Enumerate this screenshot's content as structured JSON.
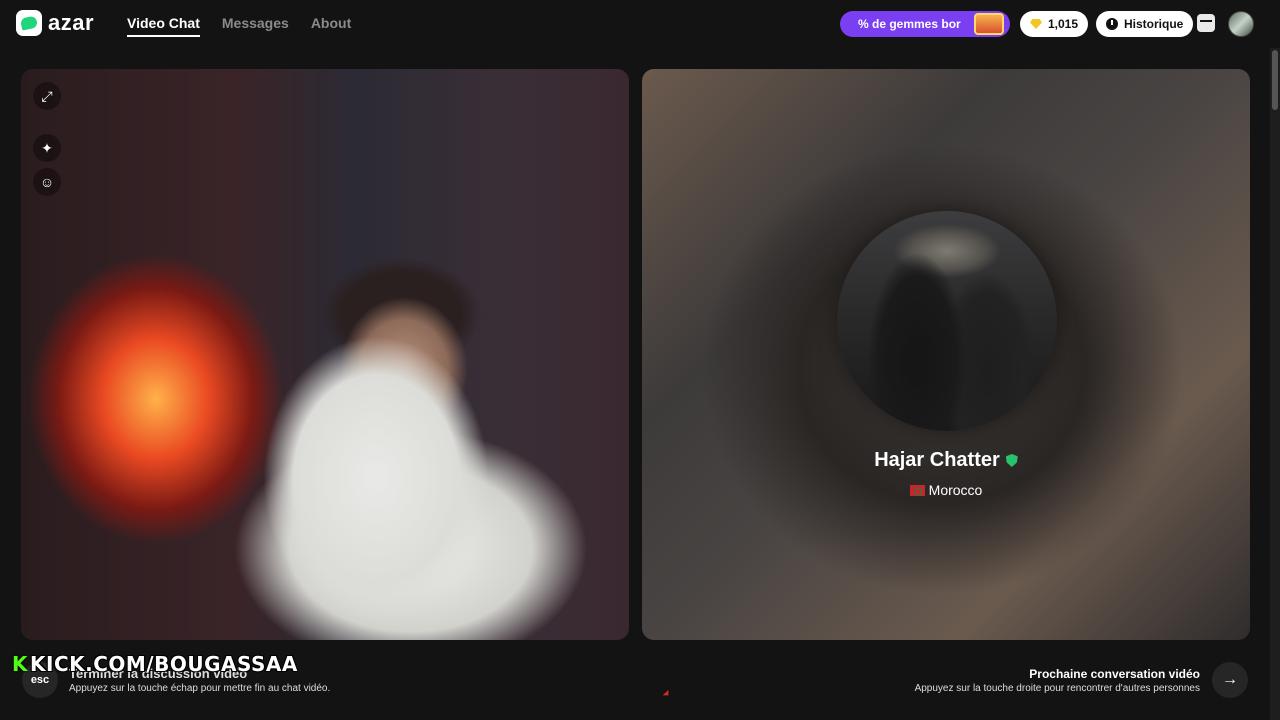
{
  "header": {
    "logo_text": "azar",
    "nav": [
      "Video Chat",
      "Messages",
      "About"
    ],
    "promo_label": "% de gemmes bor",
    "gems_count": "1,015",
    "history_label": "Historique"
  },
  "peer": {
    "name": "Hajar Chatter",
    "country": "Morocco"
  },
  "overlay": {
    "kick_k": "K",
    "kick_text": "KICK.COM/BOUGASSAA"
  },
  "footer": {
    "esc_label": "esc",
    "end_title": "Terminer la discussion vidéo",
    "end_hint": "Appuyez sur la touche échap pour mettre fin au chat vidéo.",
    "next_title": "Prochaine conversation vidéo",
    "next_hint": "Appuyez sur la touche droite pour rencontrer d'autres personnes",
    "next_arrow": "→"
  },
  "icons": {
    "expand": "⤢",
    "effects": "✦",
    "face": "☺"
  },
  "colors": {
    "accent_green": "#1fd67d",
    "promo_purple": "#7b3ff2",
    "kick_green": "#53fc18",
    "verified_green": "#27c46b"
  }
}
